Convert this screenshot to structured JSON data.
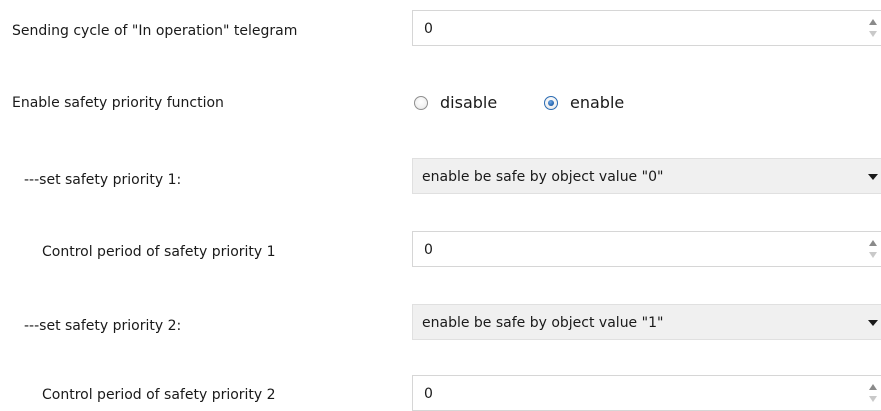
{
  "rows": {
    "sending_cycle": {
      "label": "Sending cycle of \"In operation\" telegram",
      "value": "0"
    },
    "safety_priority_function": {
      "label": "Enable safety priority function",
      "options": [
        "disable",
        "enable"
      ],
      "selected": "enable"
    },
    "set_safety_priority_1": {
      "label": "---set safety priority 1:",
      "selected": "enable be safe by object value \"0\""
    },
    "control_period_1": {
      "label": "Control period of safety priority 1",
      "value": "0"
    },
    "set_safety_priority_2": {
      "label": "---set safety priority 2:",
      "selected": "enable be safe by object value \"1\""
    },
    "control_period_2": {
      "label": "Control period of safety priority 2",
      "value": "0"
    }
  },
  "colors": {
    "accent": "#1f5fa9",
    "dropdown_background": "#f0f0f0",
    "border": "#d6d6d6"
  }
}
